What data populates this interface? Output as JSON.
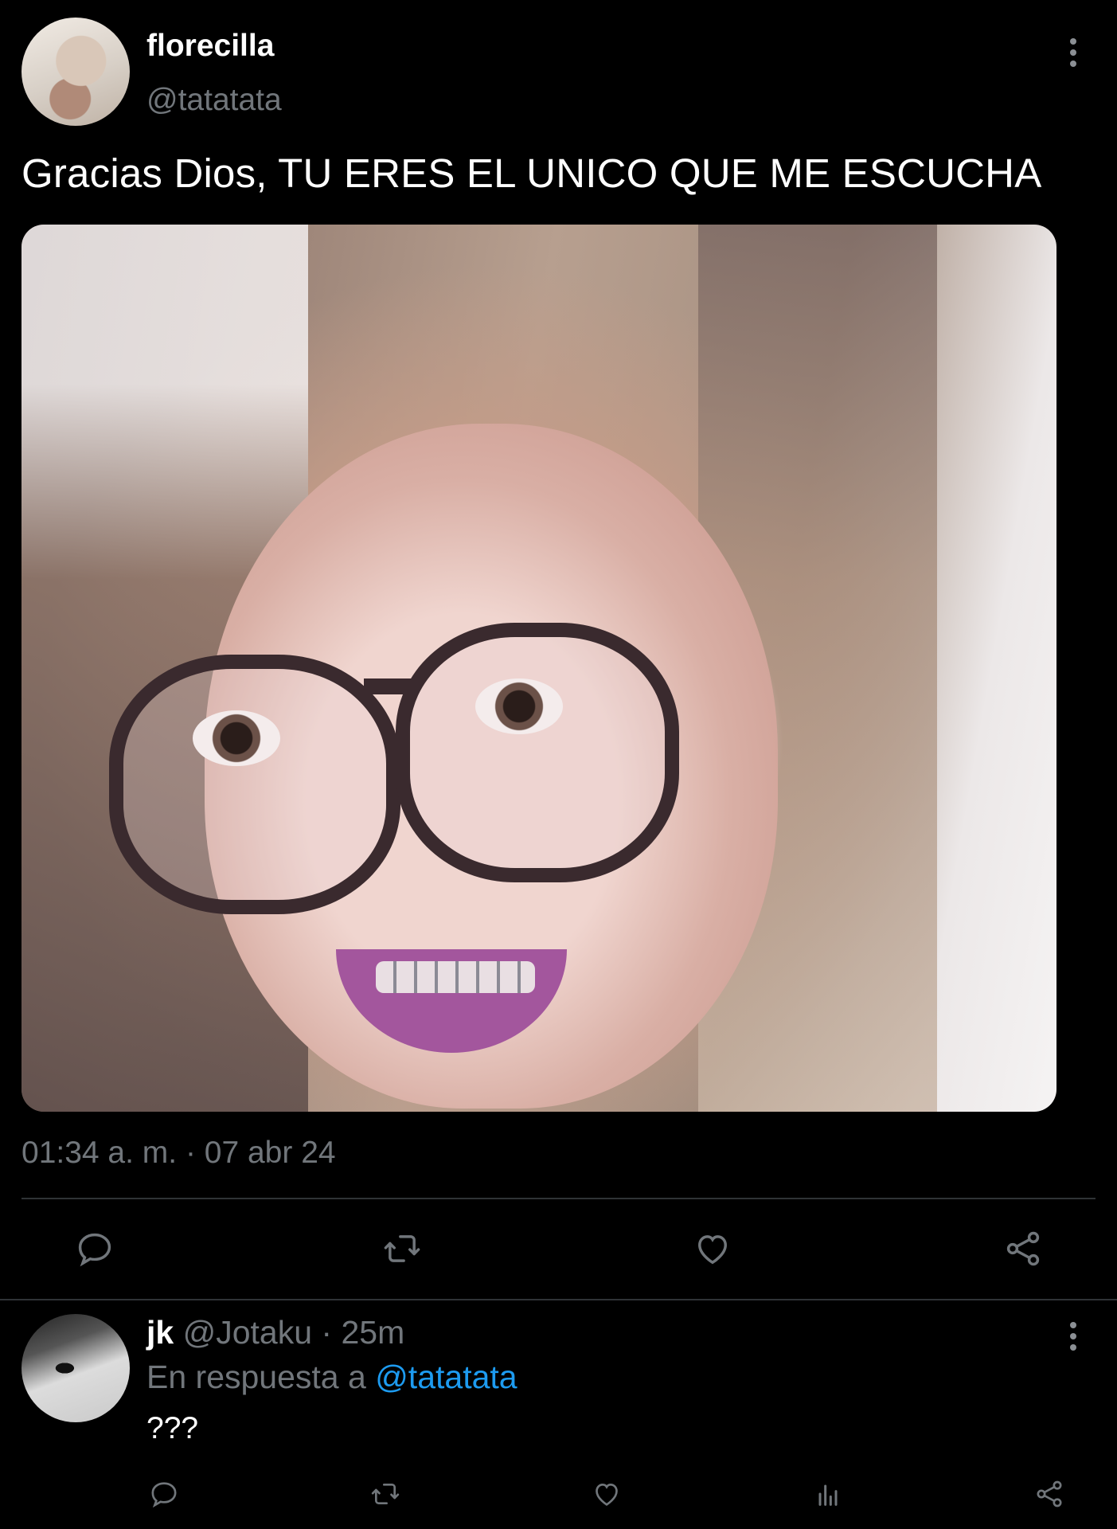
{
  "tweet": {
    "author_name": "florecilla",
    "author_handle": "@tatatata",
    "text": "Gracias Dios, TU ERES EL UNICO QUE ME ESCUCHA",
    "timestamp": "01:34 a. m. · 07 abr 24"
  },
  "actions": [
    "reply-icon",
    "retweet-icon",
    "like-icon",
    "share-icon"
  ],
  "reply": {
    "name": "jk",
    "handle": "@Jotaku",
    "separator": " · ",
    "time": "25m",
    "in_reply_prefix": "En respuesta a ",
    "in_reply_to": "@tatatata",
    "text": "???"
  },
  "reply_actions": [
    "reply-icon",
    "retweet-icon",
    "like-icon",
    "views-icon",
    "share-icon"
  ],
  "colors": {
    "background": "#000000",
    "text": "#e7e9ea",
    "muted": "#71767b",
    "link": "#1d9bf0",
    "divider": "#2f3336"
  }
}
